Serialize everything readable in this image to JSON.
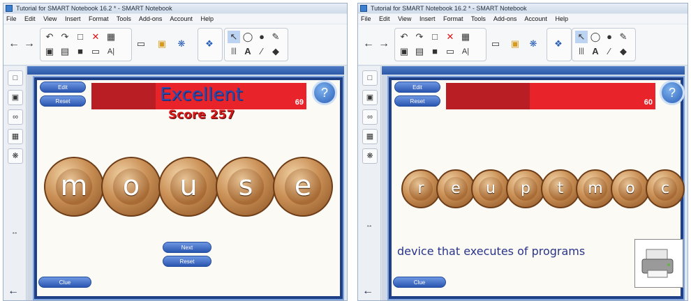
{
  "windows": [
    {
      "title": "Tutorial for SMART Notebook 16.2 * - SMART Notebook",
      "menu": [
        "File",
        "Edit",
        "View",
        "Insert",
        "Format",
        "Tools",
        "Add-ons",
        "Account",
        "Help"
      ],
      "buttons": {
        "edit": "Edit",
        "reset": "Reset",
        "next": "Next",
        "reset2": "Reset",
        "clue": "Clue"
      },
      "feedback": "Excellent",
      "score_label": "Score",
      "score_value": "257",
      "timer": "69",
      "timer_fraction": 0.3,
      "letters": [
        "m",
        "o",
        "u",
        "s",
        "e"
      ],
      "help": "?"
    },
    {
      "title": "Tutorial for SMART Notebook 16.2 * - SMART Notebook",
      "menu": [
        "File",
        "Edit",
        "View",
        "Insert",
        "Format",
        "Tools",
        "Add-ons",
        "Account",
        "Help"
      ],
      "buttons": {
        "edit": "Edit",
        "reset": "Reset",
        "clue": "Clue"
      },
      "timer": "60",
      "timer_fraction": 0.4,
      "letters": [
        "r",
        "e",
        "u",
        "p",
        "t",
        "m",
        "o",
        "c"
      ],
      "prompt": "device that executes of programs",
      "image_icon": "printer-icon",
      "help": "?"
    }
  ],
  "colors": {
    "accent": "#2b56b0",
    "timer_bar": "#e8232a",
    "letter_ball": "#c98f55"
  }
}
